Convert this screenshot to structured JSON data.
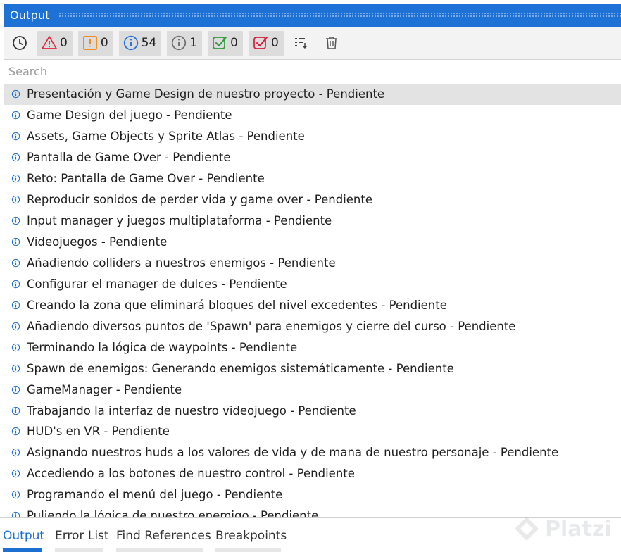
{
  "panel": {
    "title": "Output"
  },
  "toolbar": {
    "buttons": [
      {
        "icon": "clock-icon",
        "kind": "plain"
      },
      {
        "icon": "error-icon",
        "kind": "filter",
        "count": "0",
        "color": "#e0263b"
      },
      {
        "icon": "warning-icon",
        "kind": "filter",
        "count": "0",
        "color": "#f0820a"
      },
      {
        "icon": "info-icon",
        "kind": "filter",
        "count": "54",
        "color": "#1f6ed4"
      },
      {
        "icon": "info-gray-icon",
        "kind": "filter",
        "count": "1",
        "color": "#6b6b6b"
      },
      {
        "icon": "check-green-icon",
        "kind": "filter",
        "count": "0",
        "color": "#2e9b3a"
      },
      {
        "icon": "check-red-icon",
        "kind": "filter",
        "count": "0",
        "color": "#d81b3b"
      },
      {
        "icon": "filter-list-icon",
        "kind": "plain"
      },
      {
        "icon": "trash-icon",
        "kind": "plain"
      }
    ]
  },
  "search": {
    "placeholder": "Search",
    "value": ""
  },
  "messages": [
    "Presentación y Game Design de nuestro proyecto - Pendiente",
    "Game Design del juego - Pendiente",
    "Assets, Game Objects y Sprite Atlas - Pendiente",
    "Pantalla de Game Over - Pendiente",
    "Reto: Pantalla de Game Over - Pendiente",
    "Reproducir sonidos de perder vida y game over - Pendiente",
    "Input manager y juegos multiplataforma - Pendiente",
    "Videojuegos - Pendiente",
    "Añadiendo colliders a nuestros enemigos - Pendiente",
    "Configurar el manager de dulces - Pendiente",
    "Creando la zona que eliminará bloques del nivel excedentes - Pendiente",
    "Añadiendo diversos puntos de 'Spawn' para enemigos y cierre del curso - Pendiente",
    "Terminando la lógica de waypoints - Pendiente",
    "Spawn de enemigos: Generando enemigos sistemáticamente - Pendiente",
    "GameManager - Pendiente",
    "Trabajando la interfaz de nuestro videojuego - Pendiente",
    "HUD's en VR - Pendiente",
    "Asignando nuestros huds a los valores de vida y de mana de nuestro personaje - Pendiente",
    "Accediendo a los botones de nuestro control - Pendiente",
    "Programando el menú del juego - Pendiente",
    "Puliendo la lógica de nuestro enemigo - Pendiente"
  ],
  "selected_index": 0,
  "bottom_tabs": [
    {
      "label": "Output",
      "active": true
    },
    {
      "label": "Error List",
      "active": false
    },
    {
      "label": "Find References",
      "active": false
    },
    {
      "label": "Breakpoints",
      "active": false
    }
  ],
  "watermark": {
    "text": "Platzi"
  },
  "colors": {
    "accent": "#1e72d6",
    "info_icon": "#1f6ed4",
    "selected_row": "#e3e3e3"
  }
}
